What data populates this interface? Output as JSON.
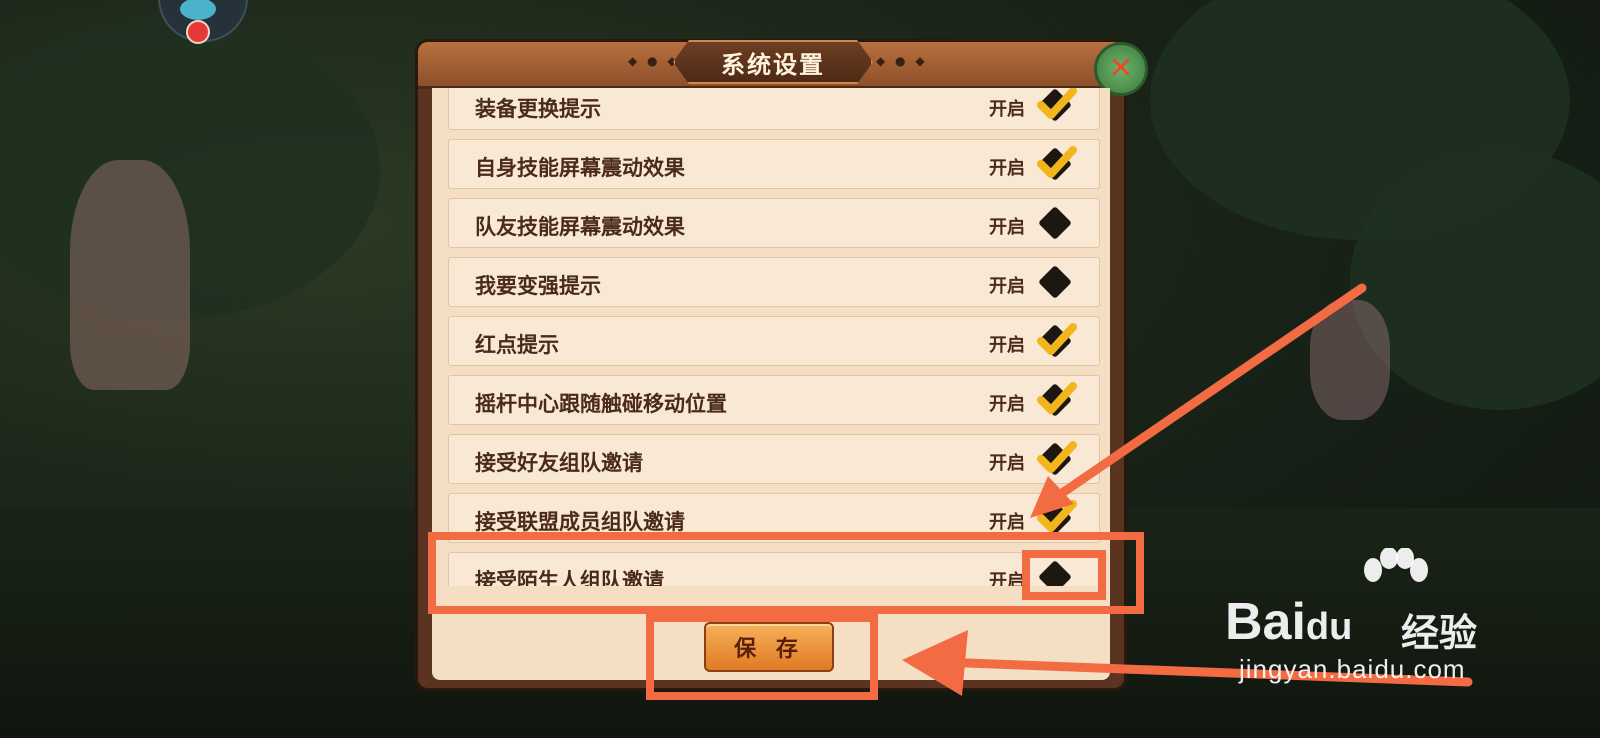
{
  "dialog": {
    "title": "系统设置",
    "close_icon": "close-x-icon",
    "save_label": "保 存"
  },
  "settings": [
    {
      "label": "装备更换提示",
      "state": "开启",
      "enabled": true
    },
    {
      "label": "自身技能屏幕震动效果",
      "state": "开启",
      "enabled": true
    },
    {
      "label": "队友技能屏幕震动效果",
      "state": "开启",
      "enabled": false
    },
    {
      "label": "我要变强提示",
      "state": "开启",
      "enabled": false
    },
    {
      "label": "红点提示",
      "state": "开启",
      "enabled": true
    },
    {
      "label": "摇杆中心跟随触碰移动位置",
      "state": "开启",
      "enabled": true
    },
    {
      "label": "接受好友组队邀请",
      "state": "开启",
      "enabled": true
    },
    {
      "label": "接受联盟成员组队邀请",
      "state": "开启",
      "enabled": true
    },
    {
      "label": "接受陌生人组队邀请",
      "state": "开启",
      "enabled": false
    }
  ],
  "watermark": {
    "brand": "Bai",
    "brand_du": "du",
    "suffix": "经验",
    "url": "jingyan.baidu.com"
  },
  "colors": {
    "annotation": "#f26b43",
    "check": "#f2b51c",
    "toggle_off": "#1d1712"
  }
}
